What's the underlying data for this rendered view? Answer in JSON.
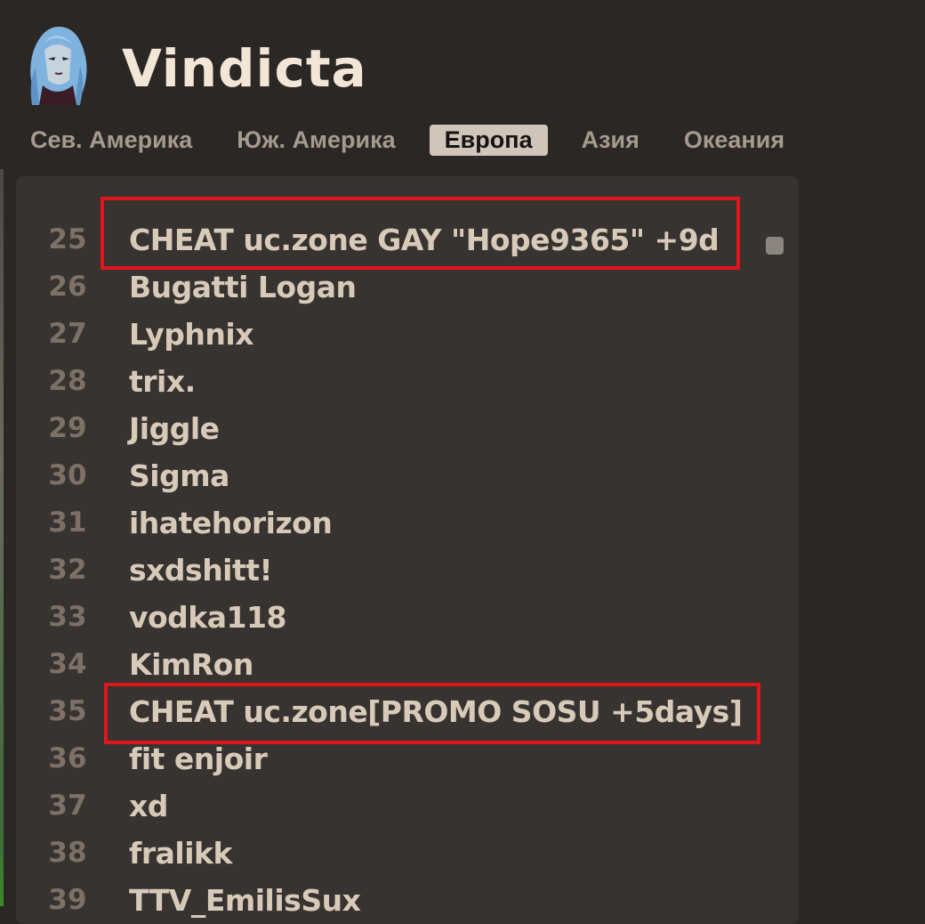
{
  "hero": {
    "name": "Vindicta",
    "icon": "vindicta-portrait-icon"
  },
  "region_tabs": [
    {
      "label": "Сев. Америка",
      "active": false
    },
    {
      "label": "Юж. Америка",
      "active": false
    },
    {
      "label": "Европа",
      "active": true
    },
    {
      "label": "Азия",
      "active": false
    },
    {
      "label": "Океания",
      "active": false
    }
  ],
  "leaderboard": {
    "rows": [
      {
        "rank": "25",
        "name": "CHEAT uc.zone GAY \"Hope9365\" +9d",
        "highlighted": true
      },
      {
        "rank": "26",
        "name": "Bugatti Logan",
        "highlighted": false
      },
      {
        "rank": "27",
        "name": "Lyphnix",
        "highlighted": false
      },
      {
        "rank": "28",
        "name": "trix.",
        "highlighted": false
      },
      {
        "rank": "29",
        "name": "Jiggle",
        "highlighted": false
      },
      {
        "rank": "30",
        "name": "Sigma",
        "highlighted": false
      },
      {
        "rank": "31",
        "name": "ihatehorizon",
        "highlighted": false
      },
      {
        "rank": "32",
        "name": "sxdshitt!",
        "highlighted": false
      },
      {
        "rank": "33",
        "name": "vodka118",
        "highlighted": false
      },
      {
        "rank": "34",
        "name": "KimRon",
        "highlighted": false
      },
      {
        "rank": "35",
        "name": "CHEAT uc.zone[PROMO SOSU +5days]",
        "highlighted": true
      },
      {
        "rank": "36",
        "name": "fit enjoir",
        "highlighted": false
      },
      {
        "rank": "37",
        "name": "xd",
        "highlighted": false
      },
      {
        "rank": "38",
        "name": "fralikk",
        "highlighted": false
      },
      {
        "rank": "39",
        "name": "TTV_EmilisSux",
        "highlighted": false
      }
    ]
  },
  "colors": {
    "background": "#2a2724",
    "panel": "#363330",
    "title": "#f2e6d6",
    "tab_text": "#a59a8e",
    "tab_active_bg": "#cfc5b8",
    "rank_text": "#7d7166",
    "name_text": "#d8cab9",
    "highlight_border": "#e0161c"
  }
}
